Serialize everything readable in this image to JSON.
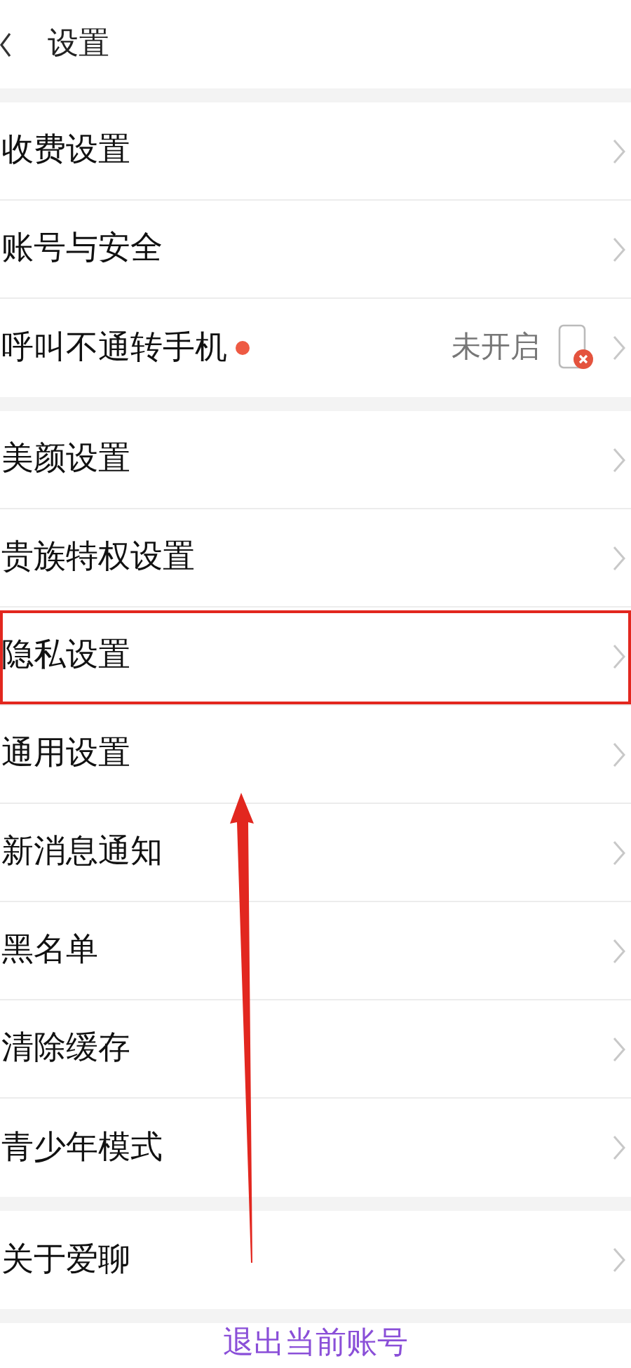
{
  "header": {
    "title": "设置"
  },
  "groups": [
    {
      "items": [
        {
          "label": "收费设置",
          "highlighted": false
        },
        {
          "label": "账号与安全",
          "highlighted": false
        },
        {
          "label": "呼叫不通转手机",
          "badge_dot": true,
          "value": "未开启",
          "highlighted": false
        }
      ]
    },
    {
      "items": [
        {
          "label": "美颜设置",
          "highlighted": false
        },
        {
          "label": "贵族特权设置",
          "highlighted": false
        },
        {
          "label": "隐私设置",
          "highlighted": true
        },
        {
          "label": "通用设置",
          "highlighted": false
        },
        {
          "label": "新消息通知",
          "highlighted": false
        },
        {
          "label": "黑名单",
          "highlighted": false
        },
        {
          "label": "清除缓存",
          "highlighted": false
        },
        {
          "label": "青少年模式",
          "highlighted": false
        }
      ]
    },
    {
      "items": [
        {
          "label": "关于爱聊",
          "highlighted": false
        }
      ]
    }
  ],
  "logout": "退出当前账号"
}
